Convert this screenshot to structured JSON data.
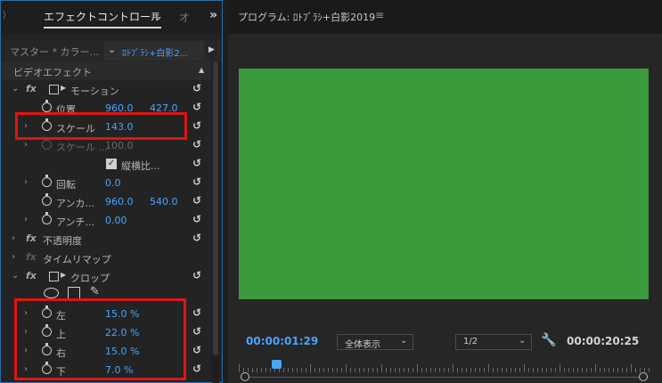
{
  "effect_panel": {
    "tab_active": "エフェクトコントロール",
    "tab_menu": "≡",
    "tab_other": "オ",
    "tab_more": "»",
    "source_label": "マスター * カラー...",
    "clip_label": "ﾛﾄﾌﾞﾗｼ+白影2...",
    "section_title": "ビデオエフェクト",
    "motion_label": "モーション",
    "position_label": "位置",
    "position_x": "960.0",
    "position_y": "427.0",
    "scale_label": "スケール",
    "scale_value": "143.0",
    "scale_width_label": "スケール ...",
    "scale_width_value": "100.0",
    "uniform_label": "縦横比...",
    "rotation_label": "回転",
    "rotation_value": "0.0",
    "anchor_label": "アンカ...",
    "anchor_x": "960.0",
    "anchor_y": "540.0",
    "antiflicker_label": "アンチ...",
    "antiflicker_value": "0.00",
    "opacity_label": "不透明度",
    "timeremap_label": "タイムリマップ",
    "crop_label": "クロップ",
    "crop_left_label": "左",
    "crop_left_value": "15.0 %",
    "crop_top_label": "上",
    "crop_top_value": "22.0 %",
    "crop_right_label": "右",
    "crop_right_value": "15.0 %",
    "crop_bottom_label": "下",
    "crop_bottom_value": "7.0 %"
  },
  "program_monitor": {
    "title": "プログラム: ﾛﾄﾌﾞﾗｼ+白影2019",
    "menu": "≡",
    "video_color": "#3a9a3c",
    "timecode_current": "00:00:01:29",
    "fit_select": "全体表示",
    "resolution_select": "1/2",
    "timecode_duration": "00:00:20:25"
  },
  "colors": {
    "accent_blue": "#4aa3ff",
    "highlight_red": "#e01414"
  }
}
